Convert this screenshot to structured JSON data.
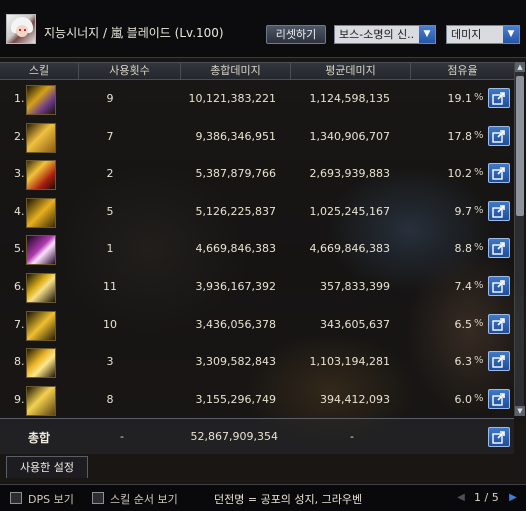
{
  "header": {
    "character_name": "지능시너지 / 嵐 블레이드 (Lv.100)",
    "reset_label": "리셋하기",
    "mode_select": "보스-소명의 신..",
    "metric_select": "데미지"
  },
  "table": {
    "columns": [
      "스킬",
      "사용횟수",
      "총합데미지",
      "평균데미지",
      "점유율"
    ],
    "pct_symbol": "%",
    "rows": [
      {
        "idx": "1.",
        "uses": "9",
        "total": "10,121,383,221",
        "avg": "1,124,598,135",
        "share": "19.1",
        "icon": "skill-1-icon"
      },
      {
        "idx": "2.",
        "uses": "7",
        "total": "9,386,346,951",
        "avg": "1,340,906,707",
        "share": "17.8",
        "icon": "skill-2-icon"
      },
      {
        "idx": "3.",
        "uses": "2",
        "total": "5,387,879,766",
        "avg": "2,693,939,883",
        "share": "10.2",
        "icon": "skill-3-icon"
      },
      {
        "idx": "4.",
        "uses": "5",
        "total": "5,126,225,837",
        "avg": "1,025,245,167",
        "share": "9.7",
        "icon": "skill-4-icon"
      },
      {
        "idx": "5.",
        "uses": "1",
        "total": "4,669,846,383",
        "avg": "4,669,846,383",
        "share": "8.8",
        "icon": "skill-5-icon"
      },
      {
        "idx": "6.",
        "uses": "11",
        "total": "3,936,167,392",
        "avg": "357,833,399",
        "share": "7.4",
        "icon": "skill-6-icon"
      },
      {
        "idx": "7.",
        "uses": "10",
        "total": "3,436,056,378",
        "avg": "343,605,637",
        "share": "6.5",
        "icon": "skill-7-icon"
      },
      {
        "idx": "8.",
        "uses": "3",
        "total": "3,309,582,843",
        "avg": "1,103,194,281",
        "share": "6.3",
        "icon": "skill-8-icon"
      },
      {
        "idx": "9.",
        "uses": "8",
        "total": "3,155,296,749",
        "avg": "394,412,093",
        "share": "6.0",
        "icon": "skill-9-icon"
      }
    ],
    "total": {
      "label": "총합",
      "uses": "-",
      "total": "52,867,909,354",
      "avg": "-"
    }
  },
  "tabs": {
    "used_settings": "사용한 설정"
  },
  "footer": {
    "dps_label": "DPS 보기",
    "order_label": "스킬 순서 보기",
    "dungeon": "던전명 = 공포의 성지, 그라우벤",
    "page": "1 / 5"
  },
  "colors": {
    "accent_blue": "#2456a6",
    "icon_gold": "#e0b21c",
    "icon_purple": "#8a2a9a"
  }
}
